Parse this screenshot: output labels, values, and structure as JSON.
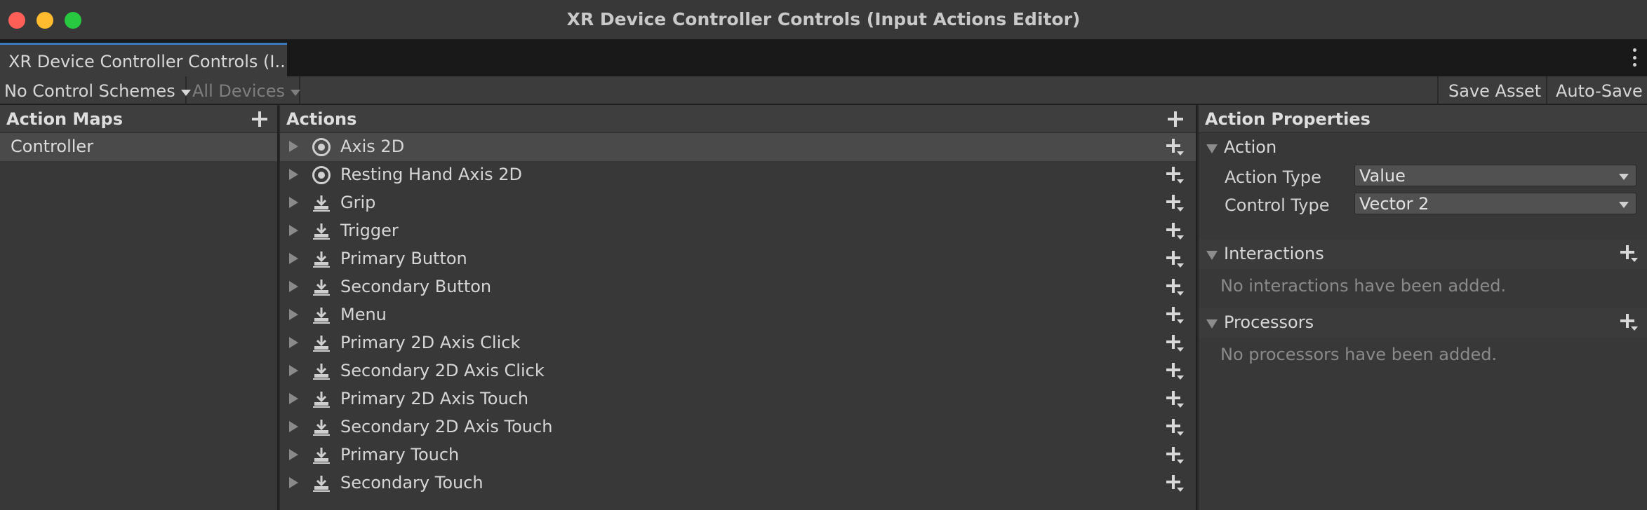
{
  "window": {
    "title": "XR Device Controller Controls (Input Actions Editor)"
  },
  "tab": {
    "label": "XR Device Controller Controls (I..."
  },
  "toolbar": {
    "control_schemes": "No Control Schemes",
    "devices": "All Devices",
    "save_asset": "Save Asset",
    "auto_save": "Auto-Save"
  },
  "action_maps": {
    "header": "Action Maps",
    "items": [
      {
        "label": "Controller",
        "selected": true
      }
    ]
  },
  "actions": {
    "header": "Actions",
    "items": [
      {
        "label": "Axis 2D",
        "icon": "value-icon",
        "selected": true
      },
      {
        "label": "Resting Hand Axis 2D",
        "icon": "value-icon"
      },
      {
        "label": "Grip",
        "icon": "button-icon"
      },
      {
        "label": "Trigger",
        "icon": "button-icon"
      },
      {
        "label": "Primary Button",
        "icon": "button-icon"
      },
      {
        "label": "Secondary Button",
        "icon": "button-icon"
      },
      {
        "label": "Menu",
        "icon": "button-icon"
      },
      {
        "label": "Primary 2D Axis Click",
        "icon": "button-icon"
      },
      {
        "label": "Secondary 2D Axis Click",
        "icon": "button-icon"
      },
      {
        "label": "Primary 2D Axis Touch",
        "icon": "button-icon"
      },
      {
        "label": "Secondary 2D Axis Touch",
        "icon": "button-icon"
      },
      {
        "label": "Primary Touch",
        "icon": "button-icon"
      },
      {
        "label": "Secondary Touch",
        "icon": "button-icon"
      }
    ]
  },
  "properties": {
    "header": "Action Properties",
    "action_section": "Action",
    "action_type_label": "Action Type",
    "action_type_value": "Value",
    "control_type_label": "Control Type",
    "control_type_value": "Vector 2",
    "interactions_section": "Interactions",
    "interactions_empty": "No interactions have been added.",
    "processors_section": "Processors",
    "processors_empty": "No processors have been added."
  },
  "colors": {
    "tab_accent": "#3a79bb",
    "close": "#ff5f57",
    "minimize": "#febc2e",
    "maximize": "#28c840"
  }
}
